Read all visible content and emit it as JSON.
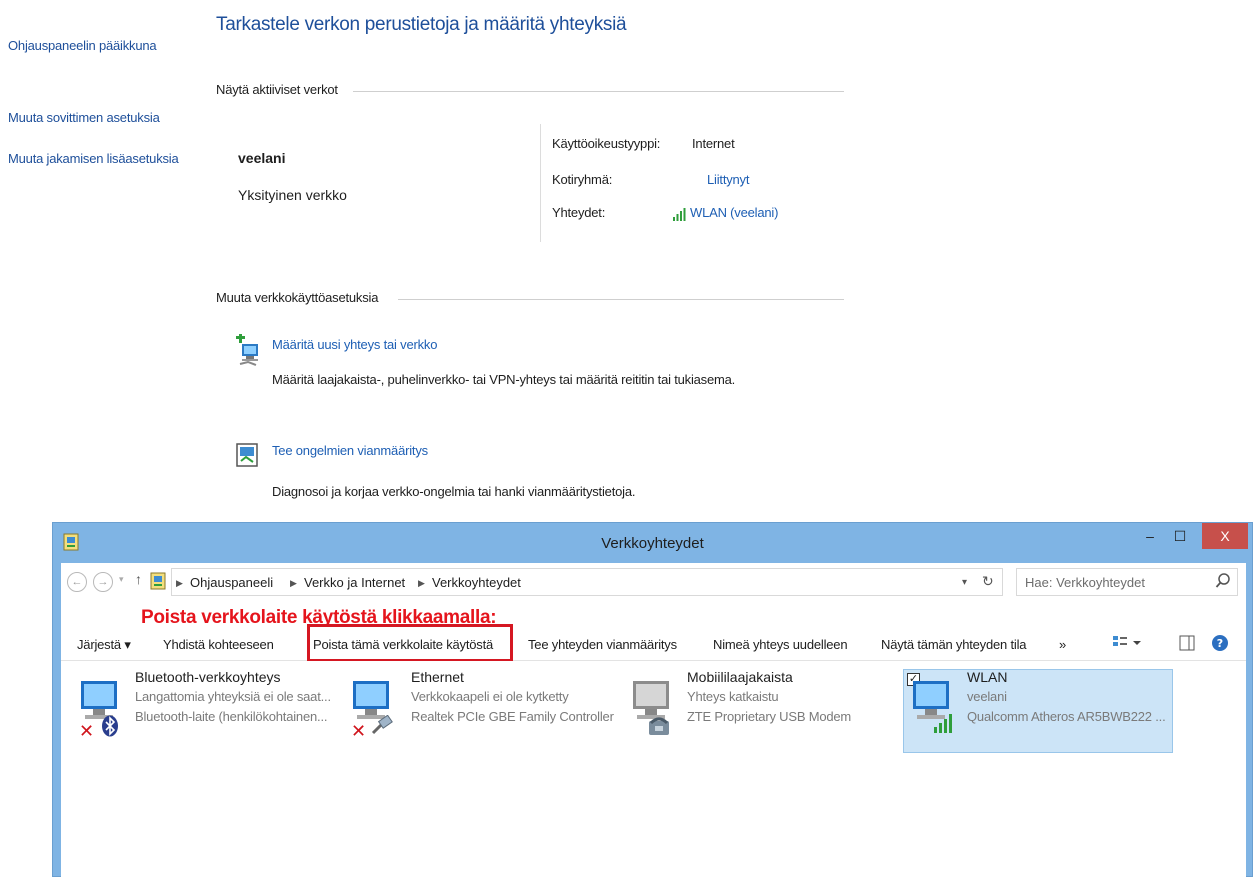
{
  "sidebar": {
    "items": [
      "Ohjauspaneelin pääikkuna",
      "Muuta sovittimen asetuksia",
      "Muuta jakamisen lisäasetuksia"
    ]
  },
  "main": {
    "title": "Tarkastele verkon perustietoja ja määritä yhteyksiä",
    "active_section": "Näytä aktiiviset verkot",
    "network": {
      "name": "veelani",
      "type": "Yksityinen verkko",
      "access_type_label": "Käyttöoikeustyyppi:",
      "access_type_value": "Internet",
      "homegroup_label": "Kotiryhmä:",
      "homegroup_value": "Liittynyt",
      "connections_label": "Yhteydet:",
      "connections_value": "WLAN (veelani)"
    },
    "change_section": "Muuta verkkokäyttöasetuksia",
    "tasks": [
      {
        "title": "Määritä uusi yhteys tai verkko",
        "desc": "Määritä laajakaista-, puhelinverkko- tai VPN-yhteys tai määritä reititin tai tukiasema."
      },
      {
        "title": "Tee ongelmien vianmääritys",
        "desc": "Diagnosoi ja korjaa verkko-ongelmia tai hanki vianmääritystietoja."
      }
    ]
  },
  "window": {
    "title": "Verkkoyhteydet",
    "minimize": "–",
    "maximize": "☐",
    "close": "X",
    "breadcrumb": [
      "Ohjauspaneeli",
      "Verkko ja Internet",
      "Verkkoyhteydet"
    ],
    "search_placeholder": "Hae: Verkkoyhteydet",
    "annotation": "Poista verkkolaite käytöstä klikkaamalla:",
    "commands": [
      "Järjestä ▾",
      "Yhdistä kohteeseen",
      "Poista tämä verkkolaite käytöstä",
      "Tee yhteyden vianmääritys",
      "Nimeä yhteys uudelleen",
      "Näytä tämän yhteyden tila",
      "»"
    ],
    "adapters": [
      {
        "name": "Bluetooth-verkkoyhteys",
        "status": "Langattomia yhteyksiä ei ole saat...",
        "device": "Bluetooth-laite (henkilökohtainen..."
      },
      {
        "name": "Ethernet",
        "status": "Verkkokaapeli ei ole kytketty",
        "device": "Realtek PCIe GBE Family Controller"
      },
      {
        "name": "Mobiililaajakaista",
        "status": "Yhteys katkaistu",
        "device": "ZTE Proprietary USB Modem"
      },
      {
        "name": "WLAN",
        "status": "veelani",
        "device": "Qualcomm Atheros AR5BWB222 ..."
      }
    ]
  },
  "colors": {
    "accent": "#1e5fb4",
    "titlebar": "#7fb4e4",
    "annotation": "#e5141c"
  }
}
